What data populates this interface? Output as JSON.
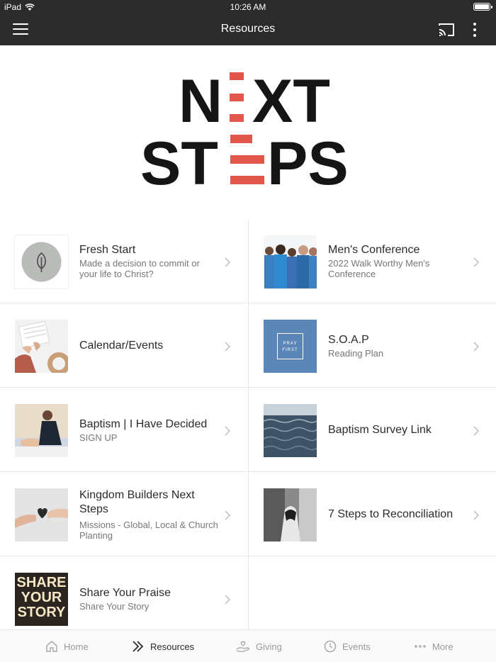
{
  "status": {
    "device": "iPad",
    "time": "10:26 AM"
  },
  "nav": {
    "title": "Resources"
  },
  "logo": {
    "line1": "NEXT",
    "line2": "STEPS"
  },
  "colors": {
    "dark": "#2b2b2b",
    "accent": "#e2574c",
    "soap_blue": "#5b86b8"
  },
  "cards": [
    {
      "title": "Fresh Start",
      "subtitle": "Made a decision to commit or your life to Christ?",
      "thumb": "leaf-icon"
    },
    {
      "title": "Men's Conference",
      "subtitle": "2022 Walk Worthy Men's Conference",
      "thumb": "men-group-photo"
    },
    {
      "title": "Calendar/Events",
      "subtitle": "",
      "thumb": "calendar-photo"
    },
    {
      "title": "S.O.A.P",
      "subtitle": "Reading Plan",
      "thumb": "pray-first-tile",
      "thumb_text": "PRAY FIRST"
    },
    {
      "title": "Baptism | I Have Decided",
      "subtitle": "SIGN UP",
      "thumb": "baptism-photo"
    },
    {
      "title": "Baptism Survey Link",
      "subtitle": "",
      "thumb": "water-photo"
    },
    {
      "title": "Kingdom Builders Next Steps",
      "subtitle": "Missions - Global, Local & Church Planting",
      "thumb": "hands-heart-photo"
    },
    {
      "title": "7 Steps to Reconciliation",
      "subtitle": "",
      "thumb": "handshake-photo"
    },
    {
      "title": "Share Your Praise",
      "subtitle": "Share Your Story",
      "thumb": "share-story-tile",
      "thumb_text": [
        "SHARE",
        "YOUR",
        "STORY"
      ]
    }
  ],
  "tabs": [
    {
      "label": "Home",
      "icon": "home-icon"
    },
    {
      "label": "Resources",
      "icon": "double-chevron-icon"
    },
    {
      "label": "Giving",
      "icon": "giving-hand-icon"
    },
    {
      "label": "Events",
      "icon": "clock-icon"
    },
    {
      "label": "More",
      "icon": "dots-icon"
    }
  ]
}
